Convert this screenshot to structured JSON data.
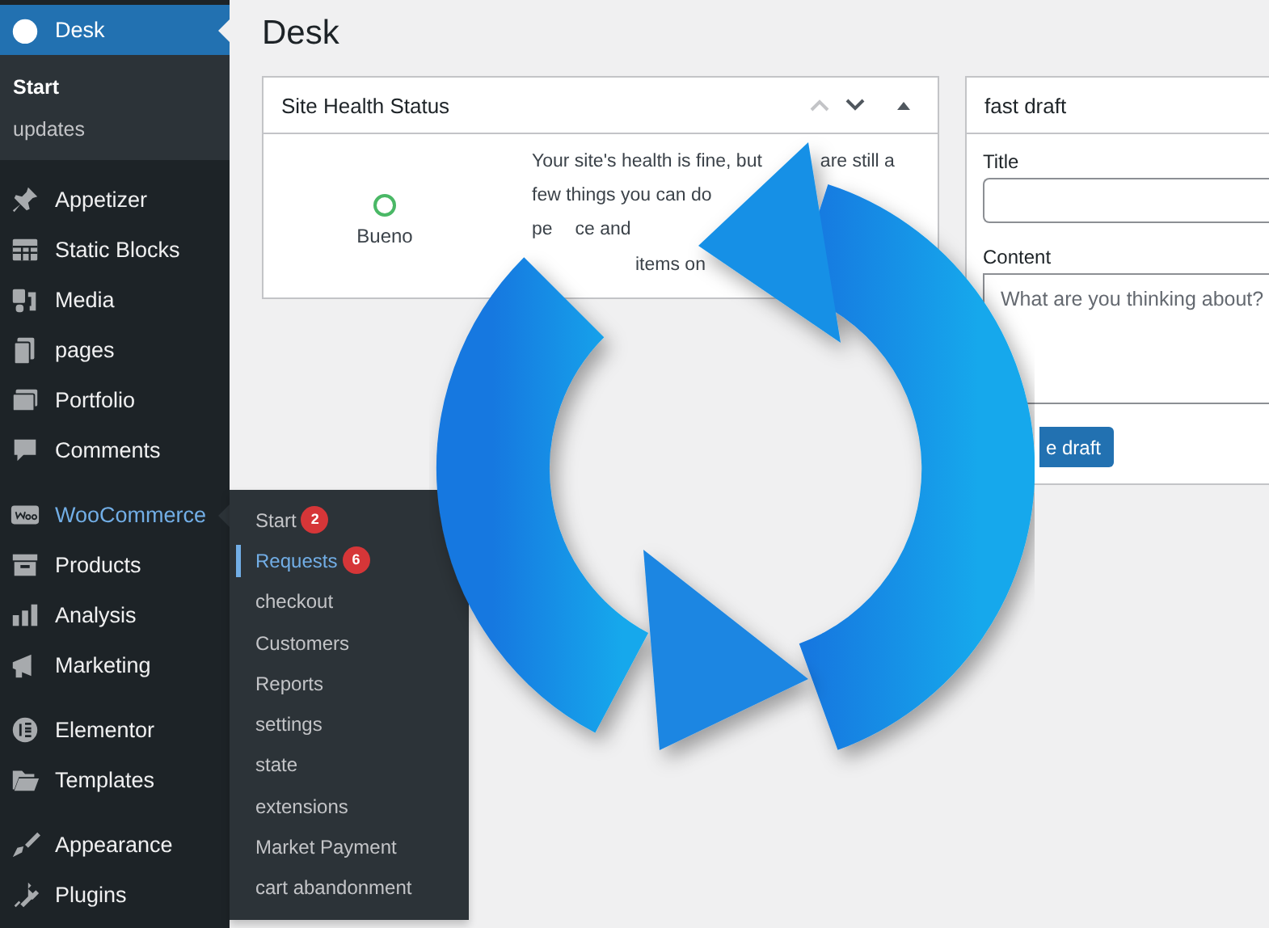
{
  "sidebar": {
    "groups": [
      {
        "items": [
          {
            "label": "Desk",
            "selected": true,
            "expanded": false,
            "submenu": [
              {
                "label": "Start",
                "selected": true
              },
              {
                "label": "updates",
                "selected": false
              }
            ]
          }
        ]
      },
      {
        "items": [
          {
            "label": "Appetizer",
            "selected": false,
            "expanded": false
          },
          {
            "label": "Static Blocks",
            "selected": false,
            "expanded": false
          },
          {
            "label": "Media",
            "selected": false,
            "expanded": false
          },
          {
            "label": "pages",
            "selected": false,
            "expanded": false
          },
          {
            "label": "Portfolio",
            "selected": false,
            "expanded": false
          },
          {
            "label": "Comments",
            "selected": false,
            "expanded": false
          }
        ]
      },
      {
        "items": [
          {
            "label": "WooCommerce",
            "selected": false,
            "expanded": true,
            "flyout": [
              {
                "label": "Start",
                "badge": "2",
                "selected": false
              },
              {
                "label": "Requests",
                "badge": "6",
                "selected": true
              },
              {
                "label": "checkout",
                "selected": false
              },
              {
                "label": "Customers",
                "selected": false
              },
              {
                "label": "Reports",
                "selected": false
              },
              {
                "label": "settings",
                "selected": false
              },
              {
                "label": "state",
                "selected": false
              },
              {
                "label": "extensions",
                "selected": false
              },
              {
                "label": "Market Payment",
                "selected": false
              },
              {
                "label": "cart abandonment",
                "selected": false
              }
            ]
          },
          {
            "label": "Products",
            "selected": false,
            "expanded": false
          },
          {
            "label": "Analysis",
            "selected": false,
            "expanded": false
          },
          {
            "label": "Marketing",
            "selected": false,
            "expanded": false
          }
        ]
      },
      {
        "items": [
          {
            "label": "Elementor",
            "selected": false,
            "expanded": false
          },
          {
            "label": "Templates",
            "selected": false,
            "expanded": false
          }
        ]
      },
      {
        "items": [
          {
            "label": "Appearance",
            "selected": false,
            "expanded": false
          },
          {
            "label": "Plugins",
            "selected": false,
            "expanded": false
          }
        ]
      }
    ]
  },
  "main": {
    "title": "Desk",
    "health": {
      "title": "Site Health Status",
      "status": "Bueno",
      "lines": [
        [
          "Your site's health is fine, but",
          "are still a"
        ],
        [
          "few things you can do"
        ],
        [
          "pe",
          "ce and"
        ],
        [
          "items on"
        ]
      ]
    },
    "draft": {
      "title": "fast draft",
      "title_label": "Title",
      "content_label": "Content",
      "content_placeholder": "What are you thinking about?",
      "button": "e draft"
    }
  }
}
